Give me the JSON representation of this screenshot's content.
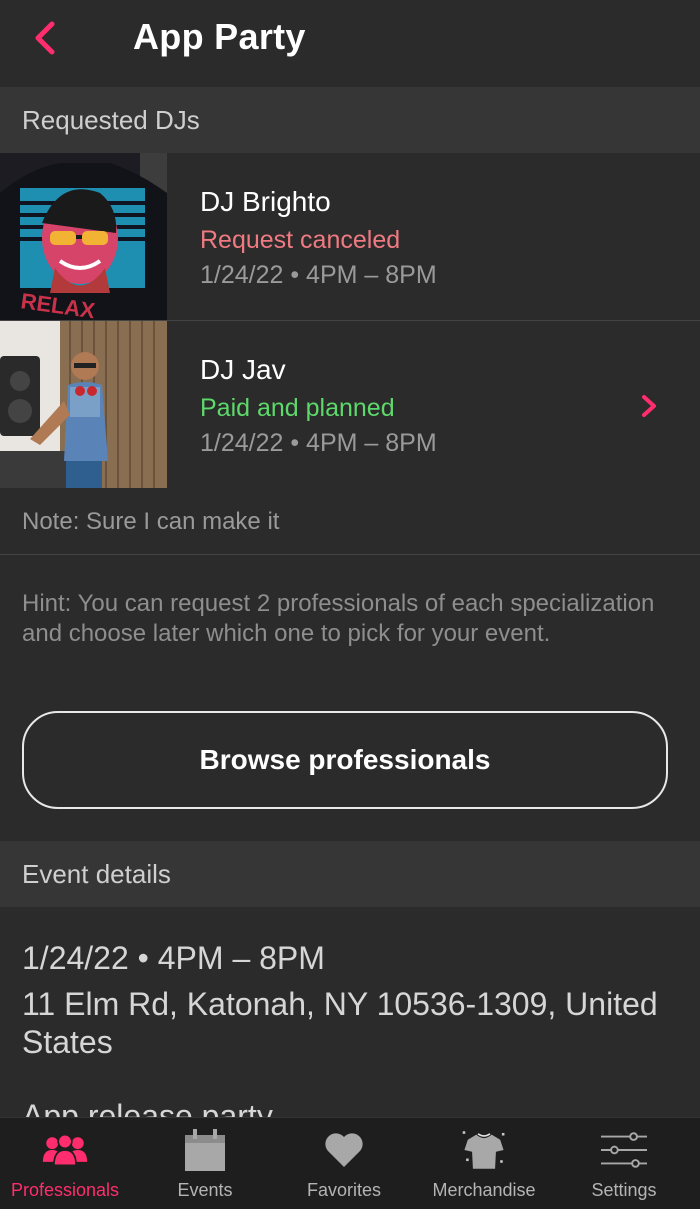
{
  "header": {
    "title": "App Party"
  },
  "requested": {
    "section_label": "Requested DJs",
    "djs": [
      {
        "name": "DJ Brighto",
        "status": "Request canceled",
        "time": "1/24/22 • 4PM – 8PM"
      },
      {
        "name": "DJ Jav",
        "status": "Paid and planned",
        "time": "1/24/22 • 4PM – 8PM"
      }
    ],
    "note": "Note: Sure I can make it",
    "hint": "Hint: You can request 2 professionals of each specialization and choose later which one to pick for your event.",
    "browse_label": "Browse professionals"
  },
  "event": {
    "section_label": "Event details",
    "date": "1/24/22 • 4PM – 8PM",
    "address": "11 Elm Rd, Katonah, NY 10536-1309, United States",
    "name": "App release party"
  },
  "tabs": [
    {
      "label": "Professionals",
      "icon": "people-icon",
      "active": true
    },
    {
      "label": "Events",
      "icon": "calendar-icon",
      "active": false
    },
    {
      "label": "Favorites",
      "icon": "heart-icon",
      "active": false
    },
    {
      "label": "Merchandise",
      "icon": "tshirt-icon",
      "active": false
    },
    {
      "label": "Settings",
      "icon": "sliders-icon",
      "active": false
    }
  ],
  "colors": {
    "accent": "#ff2d6d",
    "canceled": "#f07a82",
    "paid": "#5dd96b",
    "background": "#2b2b2b",
    "section": "#363636",
    "tabbar": "#1e1e1e"
  }
}
